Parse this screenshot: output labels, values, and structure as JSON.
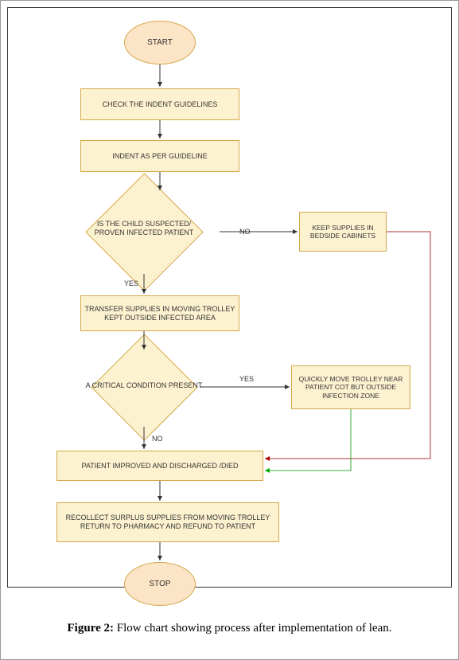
{
  "caption_label": "Figure 2:",
  "caption_text": " Flow chart showing process after implementation of lean.",
  "nodes": {
    "start": "START",
    "check": "CHECK THE INDENT GUIDELINES",
    "indent": "INDENT AS PER GUIDELINE",
    "suspected": "IS THE CHILD SUSPECTED/ PROVEN INFECTED PATIENT",
    "keep": "KEEP SUPPLIES IN BEDSIDE CABINETS",
    "transfer": "TRANSFER SUPPLIES IN MOVING TROLLEY KEPT OUTSIDE INFECTED AREA",
    "critical": "A CRITICAL CONDITION PRESENT",
    "quickly": "QUICKLY MOVE TROLLEY NEAR PATIENT COT BUT OUTSIDE INFECTION ZONE",
    "improved": "PATIENT IMPROVED AND DISCHARGED /DIED",
    "recollect": "RECOLLECT SURPLUS SUPPLIES FROM MOVING TROLLEY RETURN TO PHARMACY AND REFUND TO PATIENT",
    "stop": "STOP"
  },
  "labels": {
    "yes1": "YES",
    "no1": "NO",
    "yes2": "YES",
    "no2": "NO"
  },
  "chart_data": {
    "type": "flowchart",
    "title": "Flow chart showing process after implementation of lean",
    "nodes": [
      {
        "id": "start",
        "type": "terminator",
        "text": "START"
      },
      {
        "id": "check",
        "type": "process",
        "text": "CHECK THE INDENT GUIDELINES"
      },
      {
        "id": "indent",
        "type": "process",
        "text": "INDENT AS PER GUIDELINE"
      },
      {
        "id": "suspected",
        "type": "decision",
        "text": "IS THE CHILD SUSPECTED/ PROVEN INFECTED PATIENT"
      },
      {
        "id": "keep",
        "type": "process",
        "text": "KEEP SUPPLIES IN BEDSIDE CABINETS"
      },
      {
        "id": "transfer",
        "type": "process",
        "text": "TRANSFER SUPPLIES IN MOVING TROLLEY KEPT OUTSIDE INFECTED AREA"
      },
      {
        "id": "critical",
        "type": "decision",
        "text": "A CRITICAL CONDITION PRESENT"
      },
      {
        "id": "quickly",
        "type": "process",
        "text": "QUICKLY MOVE TROLLEY NEAR PATIENT COT BUT OUTSIDE INFECTION ZONE"
      },
      {
        "id": "improved",
        "type": "process",
        "text": "PATIENT IMPROVED AND DISCHARGED /DIED"
      },
      {
        "id": "recollect",
        "type": "process",
        "text": "RECOLLECT SURPLUS SUPPLIES FROM MOVING TROLLEY RETURN TO PHARMACY AND REFUND TO PATIENT"
      },
      {
        "id": "stop",
        "type": "terminator",
        "text": "STOP"
      }
    ],
    "edges": [
      {
        "from": "start",
        "to": "check"
      },
      {
        "from": "check",
        "to": "indent"
      },
      {
        "from": "indent",
        "to": "suspected"
      },
      {
        "from": "suspected",
        "to": "keep",
        "label": "NO"
      },
      {
        "from": "suspected",
        "to": "transfer",
        "label": "YES"
      },
      {
        "from": "transfer",
        "to": "critical"
      },
      {
        "from": "critical",
        "to": "quickly",
        "label": "YES"
      },
      {
        "from": "critical",
        "to": "improved",
        "label": "NO"
      },
      {
        "from": "keep",
        "to": "improved",
        "color": "red"
      },
      {
        "from": "quickly",
        "to": "improved",
        "color": "green"
      },
      {
        "from": "improved",
        "to": "recollect"
      },
      {
        "from": "recollect",
        "to": "stop"
      }
    ]
  }
}
